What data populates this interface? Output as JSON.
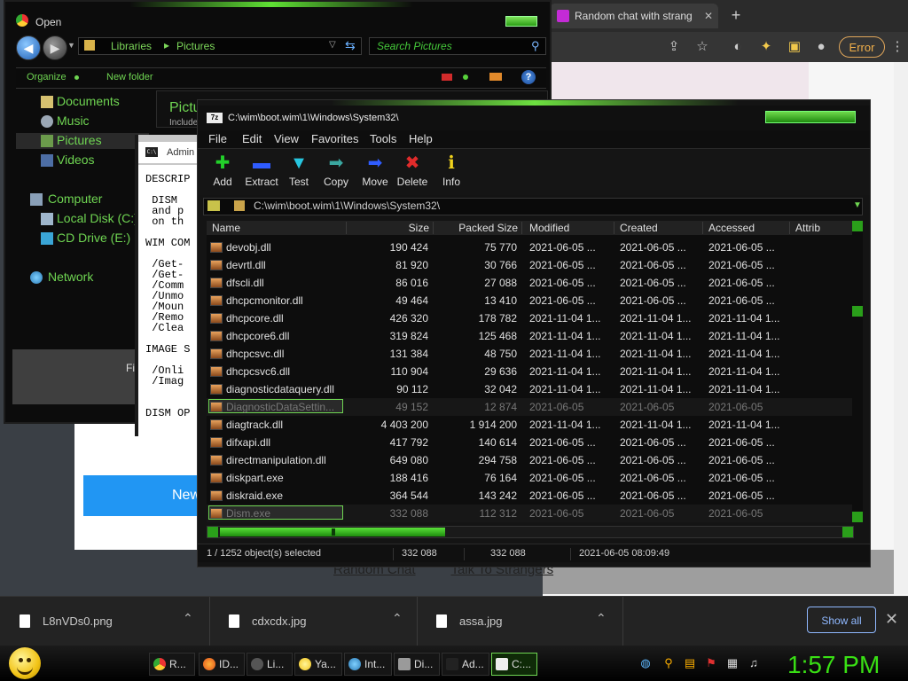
{
  "browser": {
    "tab_title": "Random chat with strang",
    "tab_close": "✕",
    "new_tab": "+",
    "error_label": "Error",
    "new_button": "New",
    "footer_links": [
      "Random Chat",
      "Talk To Strangers"
    ]
  },
  "explorer": {
    "title": "Open",
    "address": [
      "Libraries",
      "Pictures"
    ],
    "address_sep": "▸",
    "search_placeholder": "Search Pictures",
    "organize": "Organize",
    "new_folder": "New folder",
    "help": "?",
    "nav": {
      "favorites": [
        "Documents",
        "Music",
        "Pictures",
        "Videos"
      ],
      "computer": "Computer",
      "drives": [
        "Local Disk (C:)",
        "CD Drive (E:)"
      ],
      "network": "Network"
    },
    "pane_title": "Pictu",
    "pane_sub": "Include",
    "bottom_label": "Fi"
  },
  "cmd": {
    "title": "Admin",
    "text": "DESCRIP\n\n DISM\n and p\n on th\n\nWIM COM\n\n /Get-\n /Get-\n /Comm\n /Unmo\n /Moun\n /Remo\n /Clea\n\nIMAGE S\n\n /Onli\n /Imag\n\n\nDISM OP"
  },
  "zip": {
    "title": "C:\\wim\\boot.wim\\1\\Windows\\System32\\",
    "menu": [
      "File",
      "Edit",
      "View",
      "Favorites",
      "Tools",
      "Help"
    ],
    "toolbar": [
      {
        "label": "Add",
        "icon": "add-icon",
        "glyph": "✚",
        "color": "#22d02a"
      },
      {
        "label": "Extract",
        "icon": "extract-icon",
        "glyph": "▬",
        "color": "#2f5cff"
      },
      {
        "label": "Test",
        "icon": "test-icon",
        "glyph": "▼",
        "color": "#27c6e0"
      },
      {
        "label": "Copy",
        "icon": "copy-icon",
        "glyph": "➡",
        "color": "#3aa7a0"
      },
      {
        "label": "Move",
        "icon": "move-icon",
        "glyph": "➡",
        "color": "#2f5cff"
      },
      {
        "label": "Delete",
        "icon": "delete-icon",
        "glyph": "✖",
        "color": "#e12b2b"
      },
      {
        "label": "Info",
        "icon": "info-icon",
        "glyph": "ℹ",
        "color": "#f0d21c"
      }
    ],
    "path": "C:\\wim\\boot.wim\\1\\Windows\\System32\\",
    "columns": [
      "Name",
      "Size",
      "Packed Size",
      "Modified",
      "Created",
      "Accessed",
      "Attrib"
    ],
    "rows": [
      {
        "name": "devobj.dll",
        "size": "190 424",
        "packed": "75 770",
        "modified": "2021-06-05 ...",
        "created": "2021-06-05 ...",
        "accessed": "2021-06-05 ..."
      },
      {
        "name": "devrtl.dll",
        "size": "81 920",
        "packed": "30 766",
        "modified": "2021-06-05 ...",
        "created": "2021-06-05 ...",
        "accessed": "2021-06-05 ..."
      },
      {
        "name": "dfscli.dll",
        "size": "86 016",
        "packed": "27 088",
        "modified": "2021-06-05 ...",
        "created": "2021-06-05 ...",
        "accessed": "2021-06-05 ..."
      },
      {
        "name": "dhcpcmonitor.dll",
        "size": "49 464",
        "packed": "13 410",
        "modified": "2021-06-05 ...",
        "created": "2021-06-05 ...",
        "accessed": "2021-06-05 ..."
      },
      {
        "name": "dhcpcore.dll",
        "size": "426 320",
        "packed": "178 782",
        "modified": "2021-11-04 1...",
        "created": "2021-11-04 1...",
        "accessed": "2021-11-04 1..."
      },
      {
        "name": "dhcpcore6.dll",
        "size": "319 824",
        "packed": "125 468",
        "modified": "2021-11-04 1...",
        "created": "2021-11-04 1...",
        "accessed": "2021-11-04 1..."
      },
      {
        "name": "dhcpcsvc.dll",
        "size": "131 384",
        "packed": "48 750",
        "modified": "2021-11-04 1...",
        "created": "2021-11-04 1...",
        "accessed": "2021-11-04 1..."
      },
      {
        "name": "dhcpcsvc6.dll",
        "size": "110 904",
        "packed": "29 636",
        "modified": "2021-11-04 1...",
        "created": "2021-11-04 1...",
        "accessed": "2021-11-04 1..."
      },
      {
        "name": "diagnosticdataquery.dll",
        "size": "90 112",
        "packed": "32 042",
        "modified": "2021-11-04 1...",
        "created": "2021-11-04 1...",
        "accessed": "2021-11-04 1..."
      },
      {
        "name": "DiagnosticDataSettin...",
        "size": "49 152",
        "packed": "12 874",
        "modified": "2021-06-05",
        "created": "2021-06-05",
        "accessed": "2021-06-05",
        "dim": true,
        "sel": true
      },
      {
        "name": "diagtrack.dll",
        "size": "4 403 200",
        "packed": "1 914 200",
        "modified": "2021-11-04 1...",
        "created": "2021-11-04 1...",
        "accessed": "2021-11-04 1..."
      },
      {
        "name": "difxapi.dll",
        "size": "417 792",
        "packed": "140 614",
        "modified": "2021-06-05 ...",
        "created": "2021-06-05 ...",
        "accessed": "2021-06-05 ..."
      },
      {
        "name": "directmanipulation.dll",
        "size": "649 080",
        "packed": "294 758",
        "modified": "2021-06-05 ...",
        "created": "2021-06-05 ...",
        "accessed": "2021-06-05 ..."
      },
      {
        "name": "diskpart.exe",
        "size": "188 416",
        "packed": "76 164",
        "modified": "2021-06-05 ...",
        "created": "2021-06-05 ...",
        "accessed": "2021-06-05 ..."
      },
      {
        "name": "diskraid.exe",
        "size": "364 544",
        "packed": "143 242",
        "modified": "2021-06-05 ...",
        "created": "2021-06-05 ...",
        "accessed": "2021-06-05 ..."
      },
      {
        "name": "Dism.exe",
        "size": "332 088",
        "packed": "112 312",
        "modified": "2021-06-05",
        "created": "2021-06-05",
        "accessed": "2021-06-05",
        "dim": true,
        "sel": true
      }
    ],
    "status": {
      "selection": "1 / 1252 object(s) selected",
      "size": "332 088",
      "packed": "332 088",
      "date": "2021-06-05 08:09:49"
    }
  },
  "downloads": {
    "items": [
      "L8nVDs0.png",
      "cdxcdx.jpg",
      "assa.jpg"
    ],
    "show_all": "Show all",
    "close": "✕"
  },
  "taskbar": {
    "items": [
      {
        "label": "R...",
        "icon": "chrome-icon"
      },
      {
        "label": "ID...",
        "icon": "firefox-icon"
      },
      {
        "label": "Li...",
        "icon": "app-icon"
      },
      {
        "label": "Ya...",
        "icon": "smiley-icon"
      },
      {
        "label": "Int...",
        "icon": "ie-icon"
      },
      {
        "label": "Di...",
        "icon": "disk-icon"
      },
      {
        "label": "Ad...",
        "icon": "cmd-icon"
      },
      {
        "label": "C:...",
        "icon": "7zip-icon"
      }
    ],
    "clock": "1:57 PM"
  }
}
